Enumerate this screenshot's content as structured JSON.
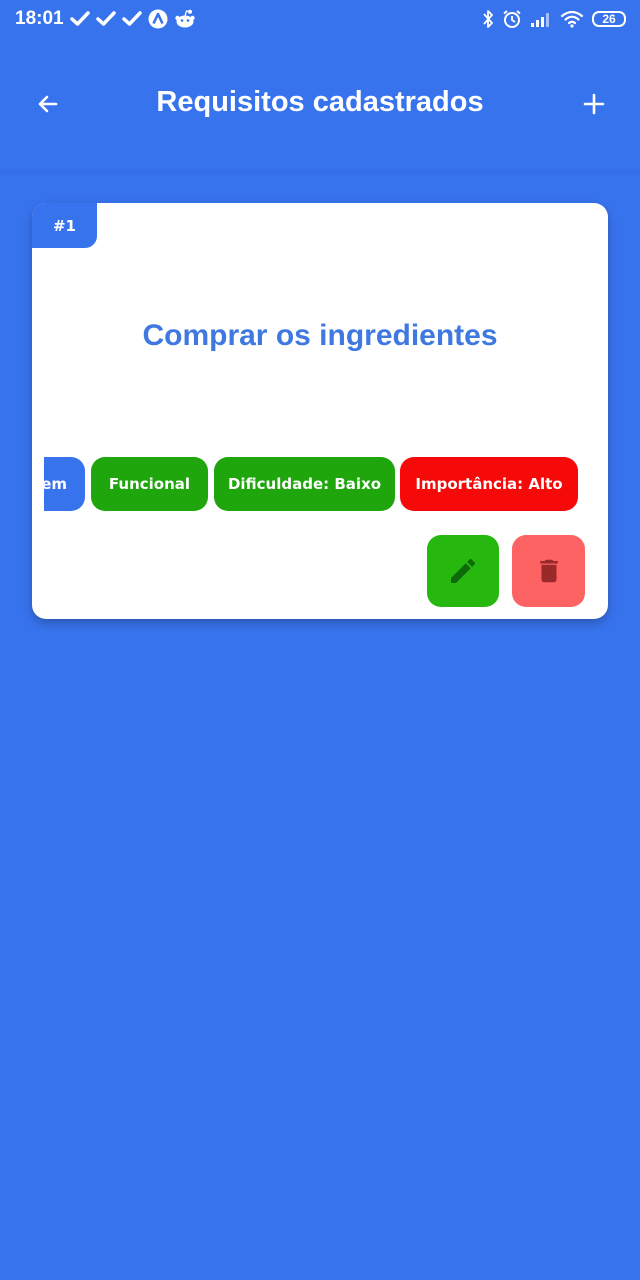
{
  "status_bar": {
    "time": "18:01",
    "battery": "26",
    "left_icons": [
      "check-icon",
      "check-icon",
      "check-icon",
      "app-icon",
      "reddit-icon"
    ],
    "right_icons": [
      "bluetooth-icon",
      "alarm-icon",
      "signal-icon",
      "wifi-icon",
      "battery-icon"
    ]
  },
  "header": {
    "title": "Requisitos cadastrados",
    "back_icon": "arrow-left-icon",
    "add_icon": "plus-icon"
  },
  "requirement": {
    "number": "#1",
    "title": "Comprar os ingredientes",
    "tags": {
      "clipped": "em",
      "type": "Funcional",
      "difficulty": "Dificuldade: Baixo",
      "importance": "Importância: Alto"
    },
    "edit_icon": "pencil-icon",
    "delete_icon": "trash-icon"
  },
  "colors": {
    "background": "#3873EE",
    "card": "#FFFFFF",
    "title_text": "#3E78E0",
    "tag_blue": "#3873EE",
    "tag_green": "#1EA60C",
    "tag_red": "#F50909",
    "edit_button": "#26B80F",
    "edit_icon": "#0E6A08",
    "delete_button": "#FE6363",
    "delete_icon": "#9A2A2A"
  }
}
